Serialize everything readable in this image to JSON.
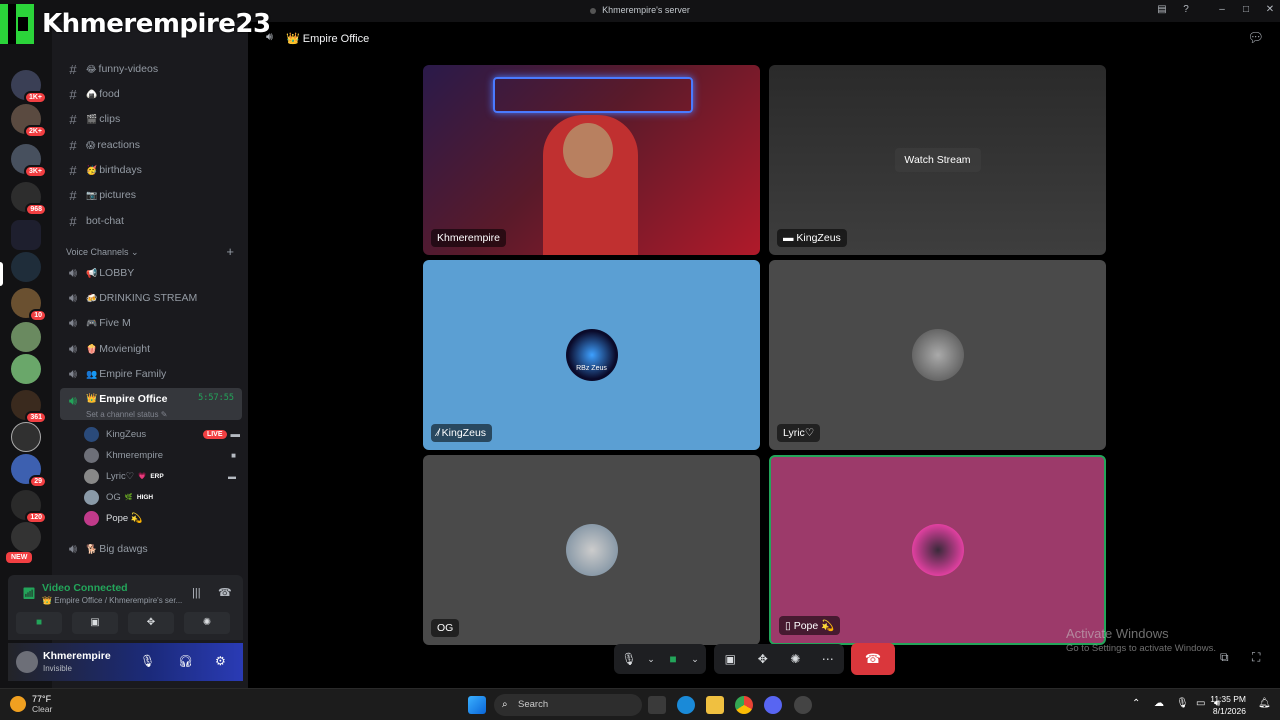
{
  "window": {
    "title": "Khmerempire's server"
  },
  "watermark": {
    "text": "Khmerempire23"
  },
  "rail": {
    "badges": [
      "1K+",
      "2K+",
      "3K+",
      "968",
      "10",
      "361",
      "29",
      "120"
    ],
    "new_label": "NEW"
  },
  "channels": {
    "text": [
      {
        "emoji": "😂",
        "name": "funny-videos"
      },
      {
        "emoji": "🍙",
        "name": "food"
      },
      {
        "emoji": "🎬",
        "name": "clips"
      },
      {
        "emoji": "😱",
        "name": "reactions"
      },
      {
        "emoji": "🥳",
        "name": "birthdays"
      },
      {
        "emoji": "📷",
        "name": "pictures"
      },
      {
        "emoji": "",
        "name": "bot-chat"
      }
    ],
    "voice_section": "Voice Channels",
    "voice": [
      {
        "emoji": "📢",
        "name": "LOBBY"
      },
      {
        "emoji": "🍻",
        "name": "DRINKING STREAM"
      },
      {
        "emoji": "🎮",
        "name": "Five M"
      },
      {
        "emoji": "🍿",
        "name": "Movienight"
      },
      {
        "emoji": "👥",
        "name": "Empire Family"
      },
      {
        "emoji": "👑",
        "name": "Empire Office",
        "timer": "5:57:55",
        "status": "Set a channel status"
      },
      {
        "emoji": "🐕",
        "name": "Big dawgs"
      }
    ],
    "members": [
      {
        "name": "KingZeus",
        "live": "LIVE"
      },
      {
        "name": "Khmerempire"
      },
      {
        "name": "Lyric♡",
        "tag": "ERP"
      },
      {
        "name": "OG",
        "tag": "HIGH"
      },
      {
        "name": "Pope 💫"
      }
    ]
  },
  "voice_panel": {
    "status": "Video Connected",
    "location": "Empire Office / Khmerempire's ser..."
  },
  "user": {
    "name": "Khmerempire",
    "status": "Invisible"
  },
  "main": {
    "room": "👑 Empire Office",
    "tiles": [
      {
        "name": "Khmerempire"
      },
      {
        "name": "KingZeus",
        "action": "Watch Stream"
      },
      {
        "name": "KingZeus",
        "avatar_text": "RBz Zeus"
      },
      {
        "name": "Lyric♡"
      },
      {
        "name": "OG"
      },
      {
        "name": "Pope 💫"
      }
    ]
  },
  "activate": {
    "title": "Activate Windows",
    "sub": "Go to Settings to activate Windows."
  },
  "taskbar": {
    "temp": "77°F",
    "weather": "Clear",
    "search": "Search",
    "time": "11:35 PM",
    "date": "8/1/2026"
  },
  "colors": {
    "accent_green": "#23a55a",
    "live_red": "#f23f42",
    "tile_blue": "#5b9fd3",
    "tile_pink": "#9c3a6a"
  }
}
